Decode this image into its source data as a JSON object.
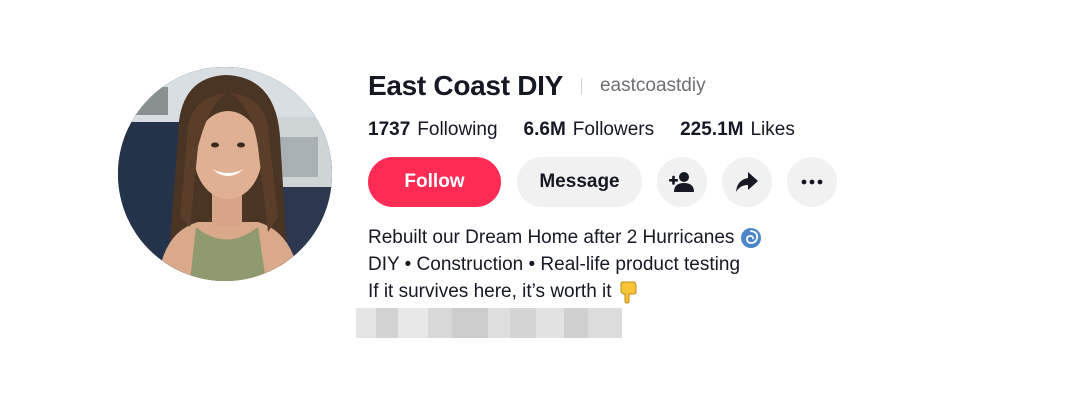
{
  "profile": {
    "display_name": "East Coast DIY",
    "username": "eastcoastdiy",
    "stats": {
      "following_count": "1737",
      "following_label": "Following",
      "followers_count": "6.6M",
      "followers_label": "Followers",
      "likes_count": "225.1M",
      "likes_label": "Likes"
    },
    "actions": {
      "follow_label": "Follow",
      "message_label": "Message",
      "add_friend_icon": "add-user-icon",
      "share_icon": "share-arrow-icon",
      "more_icon": "more-horizontal-icon"
    },
    "bio": {
      "line1": "Rebuilt our Dream Home after 2 Hurricanes",
      "line1_emoji": "cyclone-icon",
      "line2": "DIY • Construction • Real-life product testing",
      "line3": "If it survives here, it’s worth it",
      "line3_emoji": "pointing-down-hand-icon"
    },
    "colors": {
      "follow_bg": "#fe2c55",
      "button_gray": "#f1f1f2",
      "text_primary": "#161823",
      "text_secondary": "#6e6f75"
    }
  }
}
